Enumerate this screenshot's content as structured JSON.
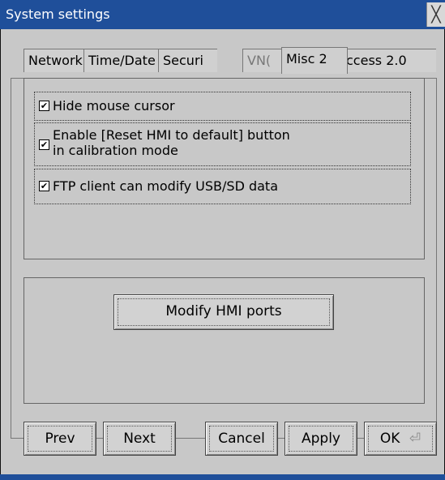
{
  "window": {
    "title": "System settings",
    "close_glyph": "╳"
  },
  "tabs": [
    {
      "label": "Network"
    },
    {
      "label": "Time/Date"
    },
    {
      "label": "Securi"
    },
    {
      "label": "VN("
    },
    {
      "label": "Misc 2"
    },
    {
      "label": "ccess 2.0"
    }
  ],
  "options": [
    {
      "label": "Hide mouse cursor",
      "checked": true
    },
    {
      "label_line1": "Enable [Reset HMI to default] button",
      "label_line2": "in calibration mode",
      "checked": true
    },
    {
      "label": "FTP client can modify USB/SD data",
      "checked": true
    }
  ],
  "modify_ports_label": "Modify HMI ports",
  "buttons": {
    "prev": "Prev",
    "next": "Next",
    "cancel": "Cancel",
    "apply": "Apply",
    "ok": "OK",
    "ok_icon": "⏎"
  },
  "colors": {
    "titlebar": "#1f4f9a",
    "background": "#c8c8c8"
  }
}
